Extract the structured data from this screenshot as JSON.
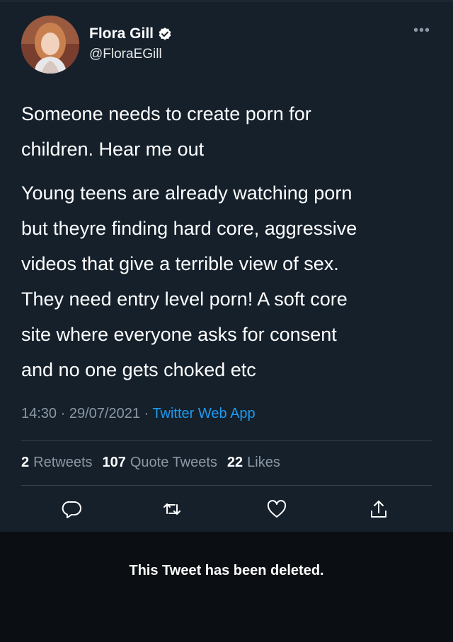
{
  "author": {
    "name": "Flora Gill",
    "handle": "@FloraEGill",
    "verified": true
  },
  "tweet": {
    "paragraph1": "Someone needs to create porn for\nchildren. Hear me out",
    "paragraph2": "Young teens are already watching porn\nbut theyre finding hard core, aggressive\nvideos that give a terrible view of sex.\nThey need entry level porn! A soft core\nsite where everyone asks for consent\nand no one gets choked etc",
    "time": "14:30",
    "date": "29/07/2021",
    "separator": "·",
    "source": "Twitter Web App"
  },
  "stats": {
    "retweets_count": "2",
    "retweets_label": "Retweets",
    "quotes_count": "107",
    "quotes_label": "Quote Tweets",
    "likes_count": "22",
    "likes_label": "Likes"
  },
  "more_label": "•••",
  "deleted_notice": "This Tweet has been deleted.",
  "icons": {
    "reply": "reply-icon",
    "retweet": "retweet-icon",
    "like": "heart-icon",
    "share": "share-icon",
    "verified": "verified-badge-icon",
    "more": "more-icon"
  },
  "colors": {
    "background": "#15202b",
    "deleted_background": "#0b0f13",
    "accent": "#1d9bf0",
    "secondary_text": "#8b98a5"
  }
}
